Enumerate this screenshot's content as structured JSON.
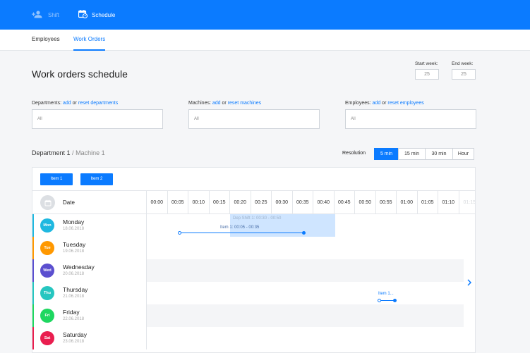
{
  "nav": {
    "shift_label": "Shift",
    "schedule_label": "Schedule"
  },
  "tabs": {
    "employees": "Employees",
    "work_orders": "Work Orders"
  },
  "page_title": "Work orders schedule",
  "week": {
    "start_label": "Start week:",
    "start_value": "25",
    "end_label": "End week:",
    "end_value": "25"
  },
  "filters": {
    "separator": "or",
    "departments": {
      "label": "Departments:",
      "add": "add",
      "reset": "reset departments",
      "value": "All"
    },
    "machines": {
      "label": "Machines:",
      "add": "add",
      "reset": "reset machines",
      "value": "All"
    },
    "employees": {
      "label": "Employees:",
      "add": "add",
      "reset": "reset employees",
      "value": "All"
    }
  },
  "breadcrumb": {
    "department": "Department 1",
    "separator": "/",
    "machine": "Machine 1"
  },
  "resolution": {
    "label": "Resolution",
    "options": [
      "5 min",
      "15 min",
      "30 min",
      "Hour"
    ],
    "selected": "5 min"
  },
  "items": [
    "Item 1",
    "Item 2"
  ],
  "header": {
    "date_label": "Date",
    "times": [
      "00:00",
      "00:05",
      "00:10",
      "00:15",
      "00:20",
      "00:25",
      "00:30",
      "00:35",
      "00:40",
      "00:45",
      "00:50",
      "00:55",
      "01:00",
      "01:05",
      "01:10",
      "01:15"
    ]
  },
  "days": [
    {
      "abbr": "Mon",
      "name": "Monday",
      "date": "18.06.2018",
      "color": "#1fb8e0"
    },
    {
      "abbr": "Tue",
      "name": "Tuesday",
      "date": "19.06.2018",
      "color": "#ff9800"
    },
    {
      "abbr": "Wed",
      "name": "Wednesday",
      "date": "20.06.2018",
      "color": "#5b4fcf"
    },
    {
      "abbr": "Thu",
      "name": "Thursday",
      "date": "21.06.2018",
      "color": "#26c6c0"
    },
    {
      "abbr": "Fri",
      "name": "Friday",
      "date": "22.06.2018",
      "color": "#1ed760"
    },
    {
      "abbr": "Sat",
      "name": "Saturday",
      "date": "23.06.2018",
      "color": "#e91e4f"
    }
  ],
  "events": {
    "shift_label": "Dep Shift 1: 00:30 - 00:50",
    "item_label": "Item 1: 00:05 - 00:35",
    "thursday_item_label": "Item 1..."
  },
  "colors": {
    "accent": "#0b7bff",
    "shift_block": "#cfe5ff"
  }
}
